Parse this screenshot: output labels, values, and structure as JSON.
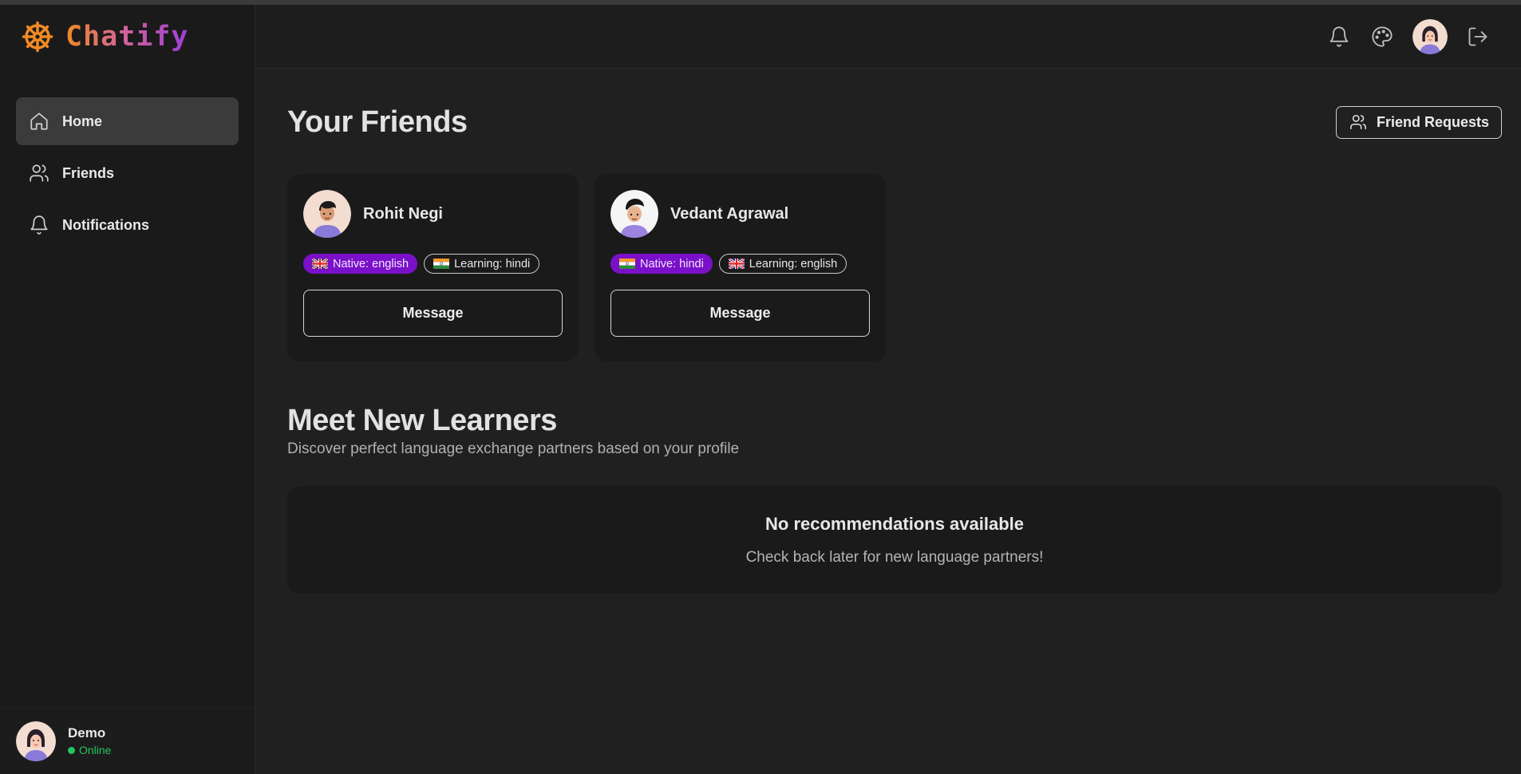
{
  "brand": {
    "name": "Chatify",
    "icon": "ship-wheel-icon"
  },
  "colors": {
    "accent": "#f08a24",
    "brand_gradient_end": "#9b3fd6",
    "native_badge": "#7a10c9",
    "online": "#22c55e",
    "active_nav": "#3b3b3b"
  },
  "sidebar": {
    "items": [
      {
        "label": "Home",
        "icon": "home-icon",
        "active": true
      },
      {
        "label": "Friends",
        "icon": "users-icon",
        "active": false
      },
      {
        "label": "Notifications",
        "icon": "bell-icon",
        "active": false
      }
    ]
  },
  "current_user": {
    "name": "Demo",
    "status": "Online"
  },
  "topbar": {
    "icons": [
      "bell-icon",
      "palette-icon",
      "avatar",
      "logout-icon"
    ]
  },
  "friends_section": {
    "title": "Your Friends",
    "requests_button": "Friend Requests"
  },
  "friends": [
    {
      "name": "Rohit Negi",
      "native": {
        "label": "Native: english",
        "flag": "uk-flag"
      },
      "learning": {
        "label": "Learning: hindi",
        "flag": "india-flag"
      },
      "button": "Message"
    },
    {
      "name": "Vedant Agrawal",
      "native": {
        "label": "Native: hindi",
        "flag": "india-flag"
      },
      "learning": {
        "label": "Learning: english",
        "flag": "uk-flag"
      },
      "button": "Message"
    }
  ],
  "learners_section": {
    "title": "Meet New Learners",
    "subtitle": "Discover perfect language exchange partners based on your profile",
    "empty_title": "No recommendations available",
    "empty_subtitle": "Check back later for new language partners!"
  }
}
